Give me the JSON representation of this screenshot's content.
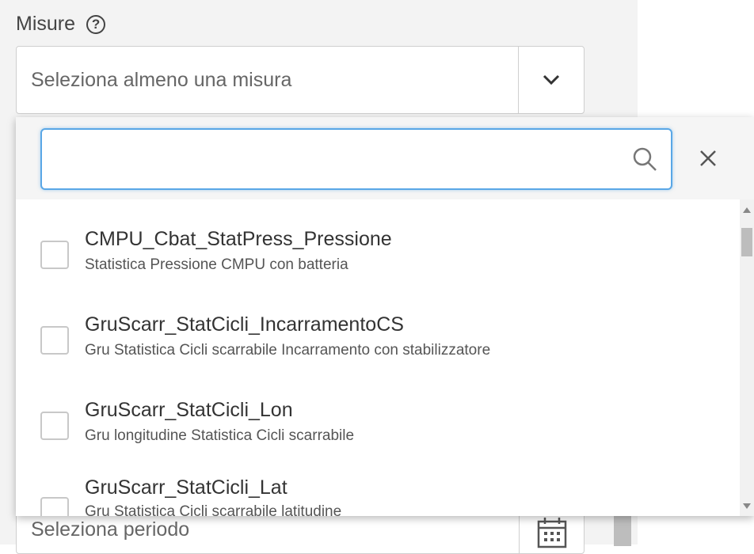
{
  "measures": {
    "label": "Misure",
    "help_icon": "question-circle-icon",
    "select_placeholder": "Seleziona almeno una misura",
    "toggle_icon": "chevron-down-icon"
  },
  "dropdown": {
    "search_value": "",
    "search_icon": "search-icon",
    "clear_icon": "close-icon",
    "items": [
      {
        "title": "CMPU_Cbat_StatPress_Pressione",
        "subtitle": "Statistica Pressione CMPU con batteria",
        "checked": false
      },
      {
        "title": "GruScarr_StatCicli_IncarramentoCS",
        "subtitle": "Gru Statistica Cicli scarrabile Incarramento con stabilizzatore",
        "checked": false
      },
      {
        "title": "GruScarr_StatCicli_Lon",
        "subtitle": "Gru longitudine Statistica Cicli scarrabile",
        "checked": false
      },
      {
        "title": "GruScarr_StatCicli_Lat",
        "subtitle": "Gru Statistica Cicli scarrabile latitudine",
        "checked": false
      }
    ]
  },
  "period": {
    "placeholder": "Seleziona periodo",
    "icon": "calendar-icon"
  },
  "colors": {
    "panel_bg": "#f3f3f3",
    "focus_border": "#5aa7e6",
    "text": "#333333"
  }
}
